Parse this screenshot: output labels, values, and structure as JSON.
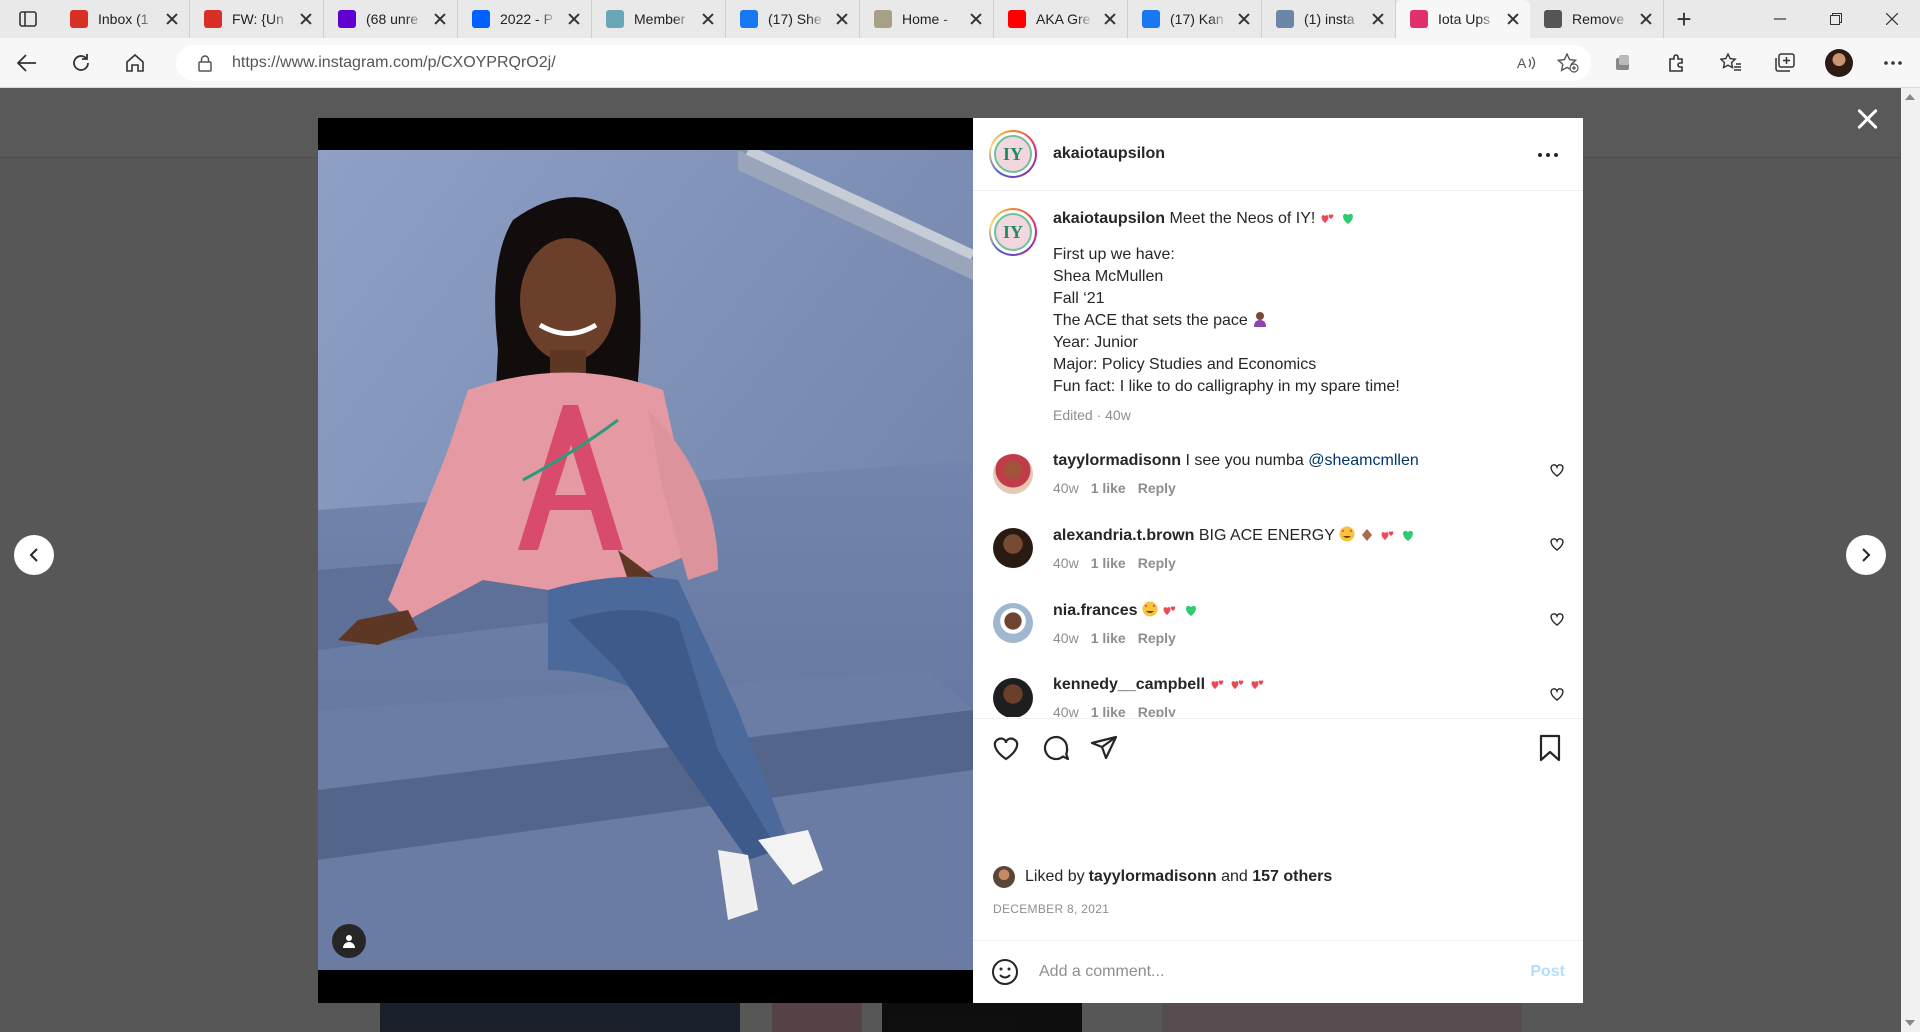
{
  "browser": {
    "tabs": [
      {
        "title": "Inbox (1",
        "icon": "gmail-icon",
        "color": "#d93025"
      },
      {
        "title": "FW: {Un",
        "icon": "gmail-icon",
        "color": "#d93025"
      },
      {
        "title": "(68 unre",
        "icon": "mail-icon",
        "color": "#6001d2"
      },
      {
        "title": "2022 - P",
        "icon": "dropbox-icon",
        "color": "#0061fe"
      },
      {
        "title": "Member",
        "icon": "member-site-icon",
        "color": "#6aa6b8"
      },
      {
        "title": "(17) She",
        "icon": "facebook-icon",
        "color": "#1877f2"
      },
      {
        "title": "Home -",
        "icon": "home-site-icon",
        "color": "#a7a087"
      },
      {
        "title": "AKA Gre",
        "icon": "youtube-icon",
        "color": "#ff0000"
      },
      {
        "title": "(17) Kan",
        "icon": "facebook-icon",
        "color": "#1877f2"
      },
      {
        "title": "(1) insta",
        "icon": "search-icon",
        "color": "#6b86a6"
      },
      {
        "title": "Iota Ups",
        "icon": "instagram-icon",
        "color": "#e1306c",
        "active": true
      },
      {
        "title": "Remove",
        "icon": "remove-site-icon",
        "color": "#555555"
      }
    ],
    "url": "https://www.instagram.com/p/CXOYPRQrO2j/"
  },
  "post": {
    "username": "akaiotaupsilon",
    "caption_text": "Meet the Neos of IY!",
    "caption_lines": [
      "First up we have:",
      "Shea McMullen",
      "Fall ‘21",
      "The ACE that sets the pace",
      "Year: Junior",
      "Major: Policy Studies and Economics",
      "Fun fact: I like to do calligraphy in my spare time!"
    ],
    "edited": "Edited · 40w",
    "comments": [
      {
        "user": "tayylormadisonn",
        "text": "I see you numba ",
        "mention": "@sheamcmllen",
        "age": "40w",
        "likes": "1 like",
        "reply": "Reply"
      },
      {
        "user": "alexandria.t.brown",
        "text": "BIG ACE ENERGY",
        "age": "40w",
        "likes": "1 like",
        "reply": "Reply"
      },
      {
        "user": "nia.frances",
        "text": "",
        "age": "40w",
        "likes": "1 like",
        "reply": "Reply"
      },
      {
        "user": "kennedy__campbell",
        "text": "",
        "age": "40w",
        "likes": "1 like",
        "reply": "Reply"
      }
    ],
    "liked_by_prefix": "Liked by ",
    "liked_by_user": "tayylormadisonn",
    "liked_by_and": " and ",
    "liked_by_others": "157 others",
    "date": "DECEMBER 8, 2021",
    "comment_placeholder": "Add a comment...",
    "post_label": "Post"
  },
  "colors": {
    "instagram_blue_disabled": "#b2dffc",
    "text_primary": "#262626",
    "text_secondary": "#8e8e8e",
    "heart_red": "#ed4956"
  }
}
